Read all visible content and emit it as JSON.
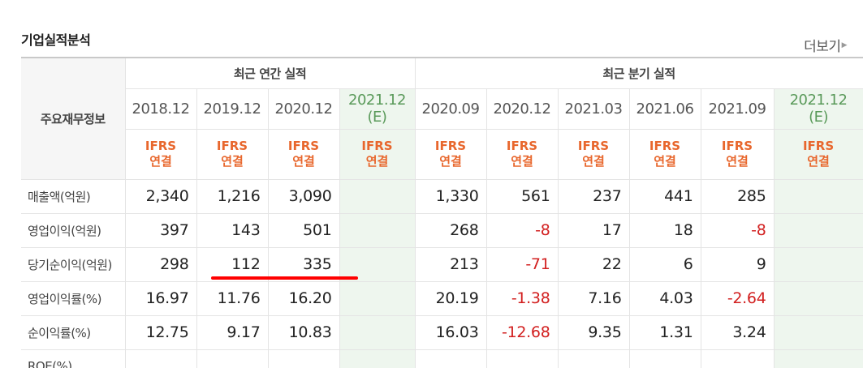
{
  "title": "기업실적분석",
  "more_label": "더보기",
  "corner_label": "주요재무정보",
  "groups": {
    "annual": "최근 연간 실적",
    "quarterly": "최근 분기 실적"
  },
  "periods": [
    "2018.12",
    "2019.12",
    "2020.12",
    "2021.12\n(E)",
    "2020.09",
    "2020.12",
    "2021.03",
    "2021.06",
    "2021.09",
    "2021.12\n(E)"
  ],
  "ifrs_label": "IFRS\n연결",
  "rows": [
    {
      "label": "매출액(억원)",
      "values": [
        "2,340",
        "1,216",
        "3,090",
        "",
        "1,330",
        "561",
        "237",
        "441",
        "285",
        ""
      ]
    },
    {
      "label": "영업이익(억원)",
      "values": [
        "397",
        "143",
        "501",
        "",
        "268",
        "-8",
        "17",
        "18",
        "-8",
        ""
      ]
    },
    {
      "label": "당기순이익(억원)",
      "values": [
        "298",
        "112",
        "335",
        "",
        "213",
        "-71",
        "22",
        "6",
        "9",
        ""
      ]
    },
    {
      "label": "영업이익률(%)",
      "values": [
        "16.97",
        "11.76",
        "16.20",
        "",
        "20.19",
        "-1.38",
        "7.16",
        "4.03",
        "-2.64",
        ""
      ]
    },
    {
      "label": "순이익률(%)",
      "values": [
        "12.75",
        "9.17",
        "10.83",
        "",
        "16.03",
        "-12.68",
        "9.35",
        "1.31",
        "3.24",
        ""
      ]
    },
    {
      "label": "ROE(%)",
      "values": [
        "",
        "",
        "",
        "",
        "",
        "",
        "",
        "",
        "",
        ""
      ]
    }
  ],
  "colors": {
    "negative": "#d21f1f",
    "ifrs": "#e8672d",
    "estimate_bg": "#eef6ee",
    "underline": "#ff0000"
  }
}
